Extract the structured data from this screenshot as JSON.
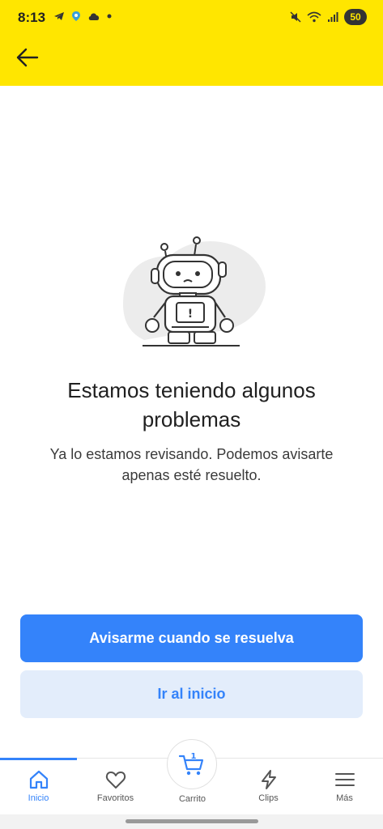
{
  "status_bar": {
    "time": "8:13",
    "battery": "50",
    "left_icons": [
      "telegram-icon",
      "maps-pin-icon",
      "cloud-icon",
      "dot-icon"
    ],
    "right_icons": [
      "mute-icon",
      "wifi-icon",
      "signal-icon"
    ]
  },
  "header": {
    "back_icon": "arrow-left-icon",
    "background": "#ffe600"
  },
  "error": {
    "title": "Estamos teniendo algunos problemas",
    "subtitle": "Ya lo estamos revisando. Podemos avisarte apenas esté resuelto.",
    "robot_badge": "!"
  },
  "actions": {
    "notify_label": "Avisarme cuando se resuelva",
    "home_label": "Ir al inicio"
  },
  "bottom_nav": {
    "items": [
      {
        "label": "Inicio",
        "icon": "home-icon",
        "active": true
      },
      {
        "label": "Favoritos",
        "icon": "heart-icon"
      },
      {
        "label": "Carrito",
        "icon": "cart-icon",
        "badge": "1"
      },
      {
        "label": "Clips",
        "icon": "bolt-icon"
      },
      {
        "label": "Más",
        "icon": "menu-icon"
      }
    ]
  },
  "colors": {
    "accent": "#3483fa",
    "accent_light": "#e3edfb",
    "brand_yellow": "#ffe600"
  }
}
